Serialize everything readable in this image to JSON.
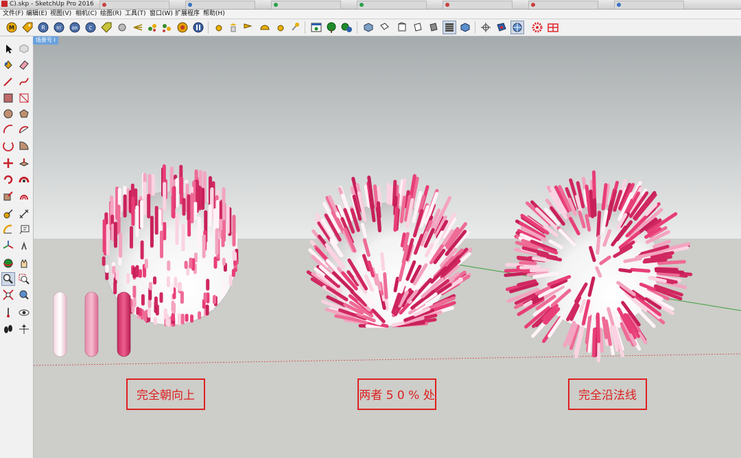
{
  "window": {
    "title": "С).skp - SketchUp Pro 2016"
  },
  "menu": [
    {
      "label": "文件(F)"
    },
    {
      "label": "编辑(E)"
    },
    {
      "label": "视图(V)"
    },
    {
      "label": "相机(C)"
    },
    {
      "label": "绘图(R)"
    },
    {
      "label": "工具(T)"
    },
    {
      "label": "窗口(W)"
    },
    {
      "label": "扩展程序"
    },
    {
      "label": "帮助(H)"
    }
  ],
  "toolbar": {
    "plugin_buttons": [
      {
        "icon": "m-plugin-icon",
        "text": "M"
      },
      {
        "icon": "r-tag-plugin-icon",
        "text": ""
      },
      {
        "icon": "r-plugin-icon",
        "text": "R"
      },
      {
        "icon": "rt-plugin-icon",
        "text": "RT"
      },
      {
        "icon": "br-plugin-icon",
        "text": "BR"
      },
      {
        "icon": "c-plugin-icon",
        "text": "C"
      },
      {
        "icon": "tag-plugin-icon",
        "text": ""
      },
      {
        "icon": "sphere-plugin-icon",
        "text": ""
      },
      {
        "icon": "spray-plugin-icon",
        "text": ""
      },
      {
        "icon": "scatter-plugin-icon",
        "text": ""
      },
      {
        "icon": "scatter-alt-plugin-icon",
        "text": ""
      },
      {
        "icon": "gear-plugin-icon",
        "text": ""
      },
      {
        "icon": "pause-plugin-icon",
        "text": ""
      }
    ],
    "accent_colors": {
      "plugin": "#e2a000",
      "blue": "#2d5fa8",
      "green": "#1e8c2a",
      "red": "#e0242a"
    }
  },
  "scene": {
    "tab_label": "场景号 I"
  },
  "captions": [
    {
      "text": "完全朝向上"
    },
    {
      "text": "两者 5 0 % 处"
    },
    {
      "text": "完全沿法线"
    }
  ],
  "colors": {
    "sky_top": "#a6abad",
    "sky_bottom": "#e9ebea",
    "ground": "#cdcdc9",
    "spike_palette": [
      "#e83e78",
      "#f3a4c0",
      "#d02860",
      "#fbd3e2",
      "#ee6b95",
      "#fff3f7",
      "#c7205a"
    ],
    "caption_red": "#dd2020"
  }
}
